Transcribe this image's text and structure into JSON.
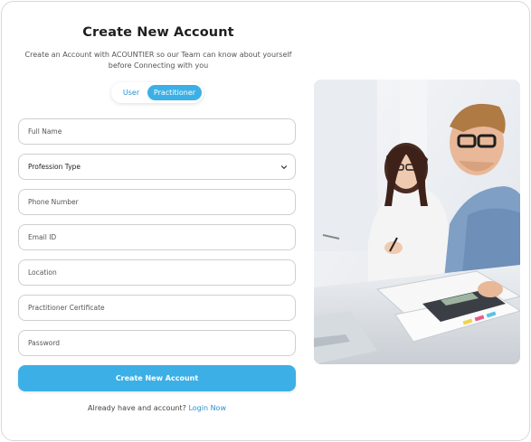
{
  "header": {
    "title": "Create New Account",
    "subtitle_line1": "Create an Account with ACOUNTIER so our Team can know about yourself",
    "subtitle_line2": "before Connecting with you"
  },
  "account_type_toggle": {
    "options": [
      "User",
      "Practitioner"
    ],
    "selected": "Practitioner"
  },
  "form": {
    "full_name": {
      "placeholder": "Full Name",
      "value": ""
    },
    "profession_type": {
      "selected": "Profession Type"
    },
    "phone_number": {
      "placeholder": "Phone Number",
      "value": ""
    },
    "email": {
      "placeholder": "Email ID",
      "value": ""
    },
    "location": {
      "placeholder": "Location",
      "value": ""
    },
    "certificate": {
      "placeholder": "Practitioner Certificate",
      "value": ""
    },
    "password": {
      "placeholder": "Password",
      "value": ""
    },
    "submit_label": "Create New Account"
  },
  "footer": {
    "prompt": "Already have and account?",
    "login_link": "Login Now"
  },
  "icons": {
    "select_chevron": "chevron-down-icon"
  },
  "colors": {
    "accent": "#3cb0e6",
    "link": "#2a8fd0",
    "border": "#cfcfcf"
  }
}
